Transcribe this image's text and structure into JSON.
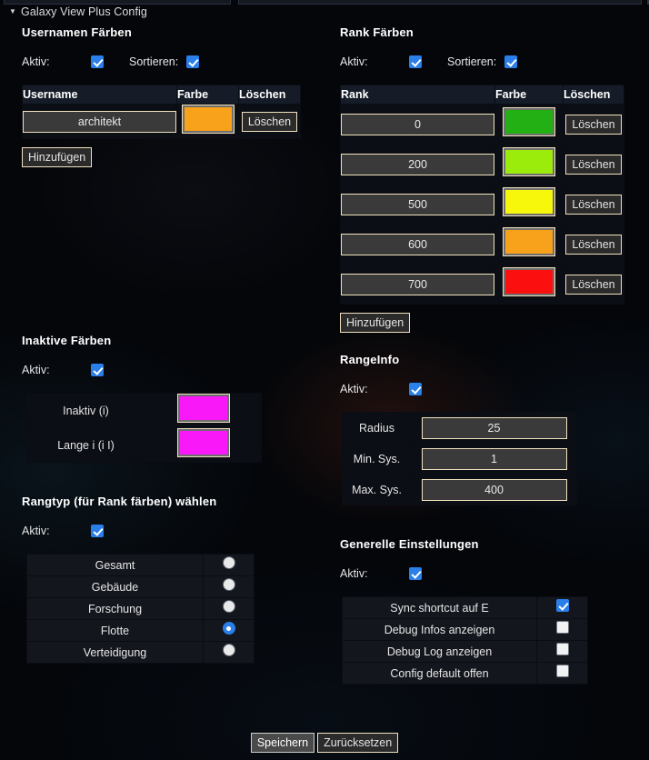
{
  "window": {
    "title": "Galaxy View Plus Config",
    "collapse_icon": "caret-down-icon"
  },
  "labels": {
    "aktiv": "Aktiv:",
    "sortieren": "Sortieren:",
    "add": "Hinzufügen",
    "delete": "Löschen"
  },
  "username_colors": {
    "title": "Usernamen Färben",
    "aktiv": true,
    "sortieren": true,
    "headers": [
      "Username",
      "Farbe",
      "Löschen"
    ],
    "rows": [
      {
        "username": "architekt",
        "color": "#f8a11a",
        "delete_label": "Löschen"
      }
    ],
    "add_label": "Hinzufügen"
  },
  "rank_colors": {
    "title": "Rank Färben",
    "aktiv": true,
    "sortieren": true,
    "headers": [
      "Rank",
      "Farbe",
      "Löschen"
    ],
    "rows": [
      {
        "rank": "0",
        "color": "#22b014",
        "delete_label": "Löschen"
      },
      {
        "rank": "200",
        "color": "#9bec0a",
        "delete_label": "Löschen"
      },
      {
        "rank": "500",
        "color": "#f7f70c",
        "delete_label": "Löschen"
      },
      {
        "rank": "600",
        "color": "#f8a11a",
        "delete_label": "Löschen"
      },
      {
        "rank": "700",
        "color": "#fc0f0f",
        "delete_label": "Löschen"
      }
    ],
    "add_label": "Hinzufügen"
  },
  "inactive_colors": {
    "title": "Inaktive Färben",
    "aktiv": true,
    "rows": [
      {
        "label": "Inaktiv (i)",
        "color": "#f818f8"
      },
      {
        "label": "Lange i (i I)",
        "color": "#f818f8"
      }
    ]
  },
  "range_info": {
    "title": "RangeInfo",
    "aktiv": true,
    "rows": [
      {
        "label": "Radius",
        "value": "25"
      },
      {
        "label": "Min. Sys.",
        "value": "1"
      },
      {
        "label": "Max. Sys.",
        "value": "400"
      }
    ]
  },
  "rank_type": {
    "title": "Rangtyp (für Rank färben) wählen",
    "aktiv": true,
    "options": [
      {
        "label": "Gesamt",
        "selected": false
      },
      {
        "label": "Gebäude",
        "selected": false
      },
      {
        "label": "Forschung",
        "selected": false
      },
      {
        "label": "Flotte",
        "selected": true
      },
      {
        "label": "Verteidigung",
        "selected": false
      }
    ]
  },
  "general_settings": {
    "title": "Generelle Einstellungen",
    "aktiv": true,
    "options": [
      {
        "label": "Sync shortcut auf E",
        "checked": true
      },
      {
        "label": "Debug Infos anzeigen",
        "checked": false
      },
      {
        "label": "Debug Log anzeigen",
        "checked": false
      },
      {
        "label": "Config default offen",
        "checked": false
      }
    ]
  },
  "footer": {
    "save_label": "Speichern",
    "reset_label": "Zurücksetzen"
  },
  "theme": {
    "accent_border": "#f2e2c0",
    "checkbox_on": "#2a7fe8",
    "panel_bg": "#0b0e14",
    "header_bg": "#151c27"
  }
}
